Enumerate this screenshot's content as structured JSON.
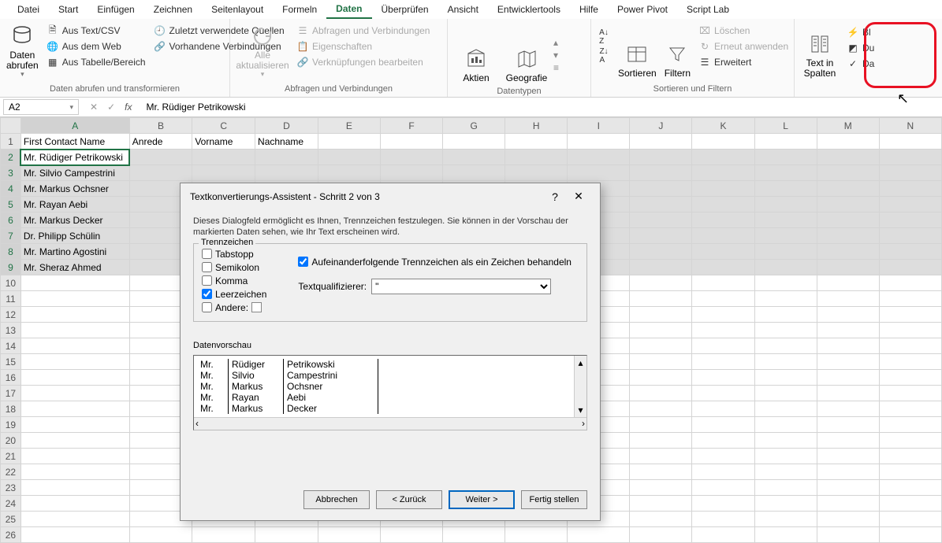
{
  "menu": {
    "items": [
      "Datei",
      "Start",
      "Einfügen",
      "Zeichnen",
      "Seitenlayout",
      "Formeln",
      "Daten",
      "Überprüfen",
      "Ansicht",
      "Entwicklertools",
      "Hilfe",
      "Power Pivot",
      "Script Lab"
    ],
    "active": "Daten"
  },
  "ribbon": {
    "g1": {
      "label": "Daten abrufen und transformieren",
      "big": "Daten\nabrufen",
      "items": [
        "Aus Text/CSV",
        "Aus dem Web",
        "Aus Tabelle/Bereich",
        "Zuletzt verwendete Quellen",
        "Vorhandene Verbindungen"
      ]
    },
    "g2": {
      "label": "Abfragen und Verbindungen",
      "big": "Alle\naktualisieren",
      "items": [
        "Abfragen und Verbindungen",
        "Eigenschaften",
        "Verknüpfungen bearbeiten"
      ]
    },
    "g3": {
      "label": "Datentypen",
      "aktien": "Aktien",
      "geo": "Geografie"
    },
    "g4": {
      "label": "Sortieren und Filtern",
      "sort": "Sortieren",
      "filter": "Filtern",
      "items": [
        "Löschen",
        "Erneut anwenden",
        "Erweitert"
      ]
    },
    "g5": {
      "text_in_spalten": "Text in\nSpalten",
      "bl": "Bl",
      "du": "Du",
      "da": "Da"
    }
  },
  "namebox": "A2",
  "formula": "Mr. Rüdiger Petrikowski",
  "headers": {
    "A": "First Contact Name",
    "B": "Anrede",
    "C": "Vorname",
    "D": "Nachname"
  },
  "rows": [
    "Mr. Rüdiger Petrikowski",
    "Mr. Silvio Campestrini",
    "Mr. Markus Ochsner",
    "Mr. Rayan Aebi",
    "Mr. Markus Decker",
    "Dr. Philipp Schülin",
    "Mr. Martino Agostini",
    "Mr. Sheraz Ahmed"
  ],
  "columns": [
    "A",
    "B",
    "C",
    "D",
    "E",
    "F",
    "G",
    "H",
    "I",
    "J",
    "K",
    "L",
    "M",
    "N"
  ],
  "dialog": {
    "title": "Textkonvertierungs-Assistent - Schritt 2 von 3",
    "instr": "Dieses Dialogfeld ermöglicht es Ihnen, Trennzeichen festzulegen. Sie können in der Vorschau der markierten Daten sehen, wie Ihr Text erscheinen wird.",
    "trenn_label": "Trennzeichen",
    "chk": {
      "tab": "Tabstopp",
      "semi": "Semikolon",
      "komma": "Komma",
      "leer": "Leerzeichen",
      "andere": "Andere:"
    },
    "auf": "Aufeinanderfolgende Trennzeichen als ein Zeichen behandeln",
    "textq_label": "Textqualifizierer:",
    "textq_value": "\"",
    "preview_label": "Datenvorschau",
    "preview_rows": [
      [
        "Mr.",
        "Rüdiger",
        "Petrikowski"
      ],
      [
        "Mr.",
        "Silvio",
        "Campestrini"
      ],
      [
        "Mr.",
        "Markus",
        "Ochsner"
      ],
      [
        "Mr.",
        "Rayan",
        "Aebi"
      ],
      [
        "Mr.",
        "Markus",
        "Decker"
      ]
    ],
    "btn": {
      "cancel": "Abbrechen",
      "back": "< Zurück",
      "next": "Weiter >",
      "finish": "Fertig stellen"
    }
  }
}
